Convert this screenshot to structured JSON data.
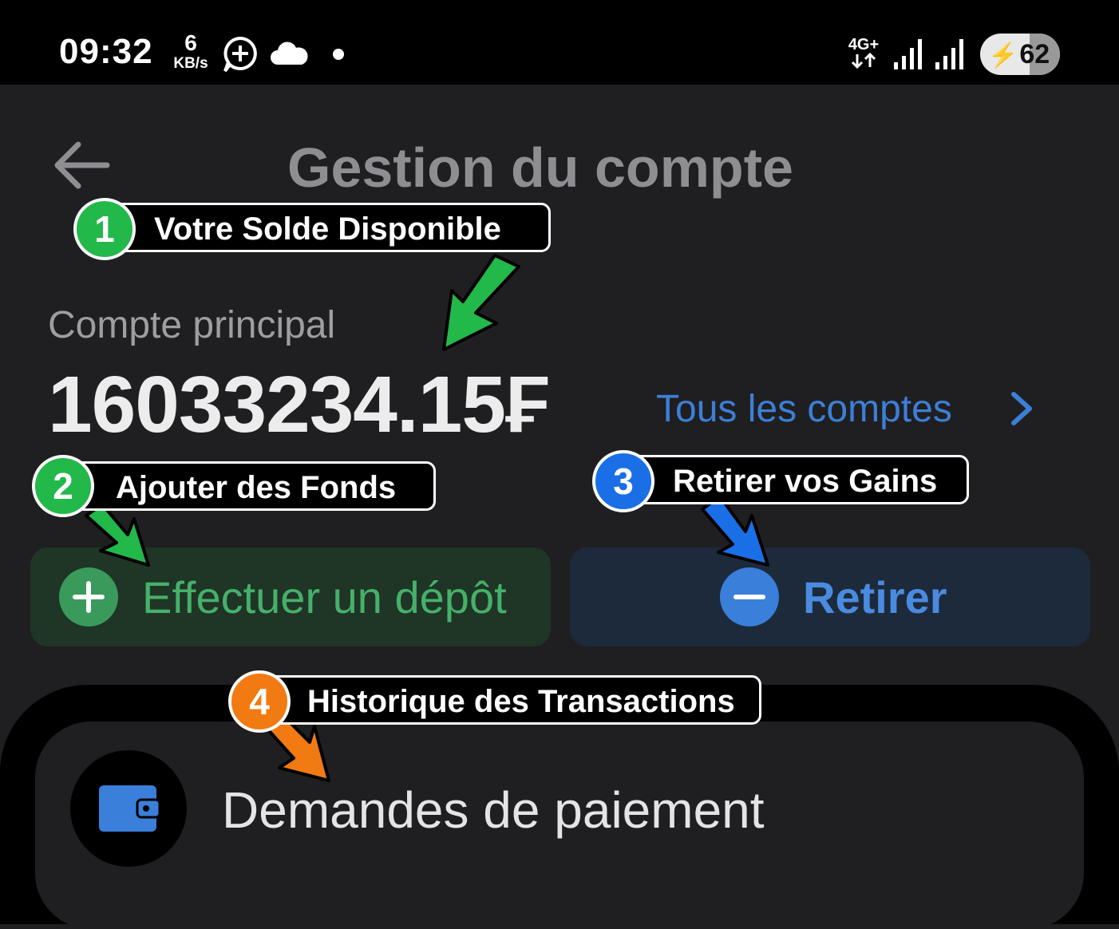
{
  "status_bar": {
    "time": "09:32",
    "net_speed_value": "6",
    "net_speed_unit": "KB/s",
    "network_type": "4G+",
    "battery_level": "62",
    "icons": [
      "whatsapp-add-icon",
      "cloud-icon",
      "notification-dot-icon",
      "signal-bars-icon",
      "signal-bars-icon",
      "charging-bolt-icon"
    ]
  },
  "header": {
    "title": "Gestion du compte",
    "back_icon": "arrow-left-icon"
  },
  "account": {
    "label": "Compte principal",
    "balance": "16033234.15₣",
    "all_accounts_link": "Tous les comptes",
    "all_accounts_icon": "chevron-right-icon"
  },
  "actions": {
    "deposit_label": "Effectuer un dépôt",
    "deposit_icon": "plus-circle-icon",
    "withdraw_label": "Retirer",
    "withdraw_icon": "minus-circle-icon"
  },
  "menu": {
    "items": [
      {
        "label": "Demandes de paiement",
        "icon": "wallet-icon"
      }
    ]
  },
  "annotations": [
    {
      "number": "1",
      "text": "Votre Solde Disponible",
      "color": "#22b84a"
    },
    {
      "number": "2",
      "text": "Ajouter des Fonds",
      "color": "#22b84a"
    },
    {
      "number": "3",
      "text": "Retirer vos Gains",
      "color": "#1a6fe6"
    },
    {
      "number": "4",
      "text": "Historique des Transactions",
      "color": "#f27a12"
    }
  ],
  "colors": {
    "background": "#1f1f21",
    "accent_blue": "#3c7fd7",
    "deposit_green": "#46b06a",
    "deposit_bg": "#1f3526",
    "withdraw_bg": "#1c2a3c"
  }
}
